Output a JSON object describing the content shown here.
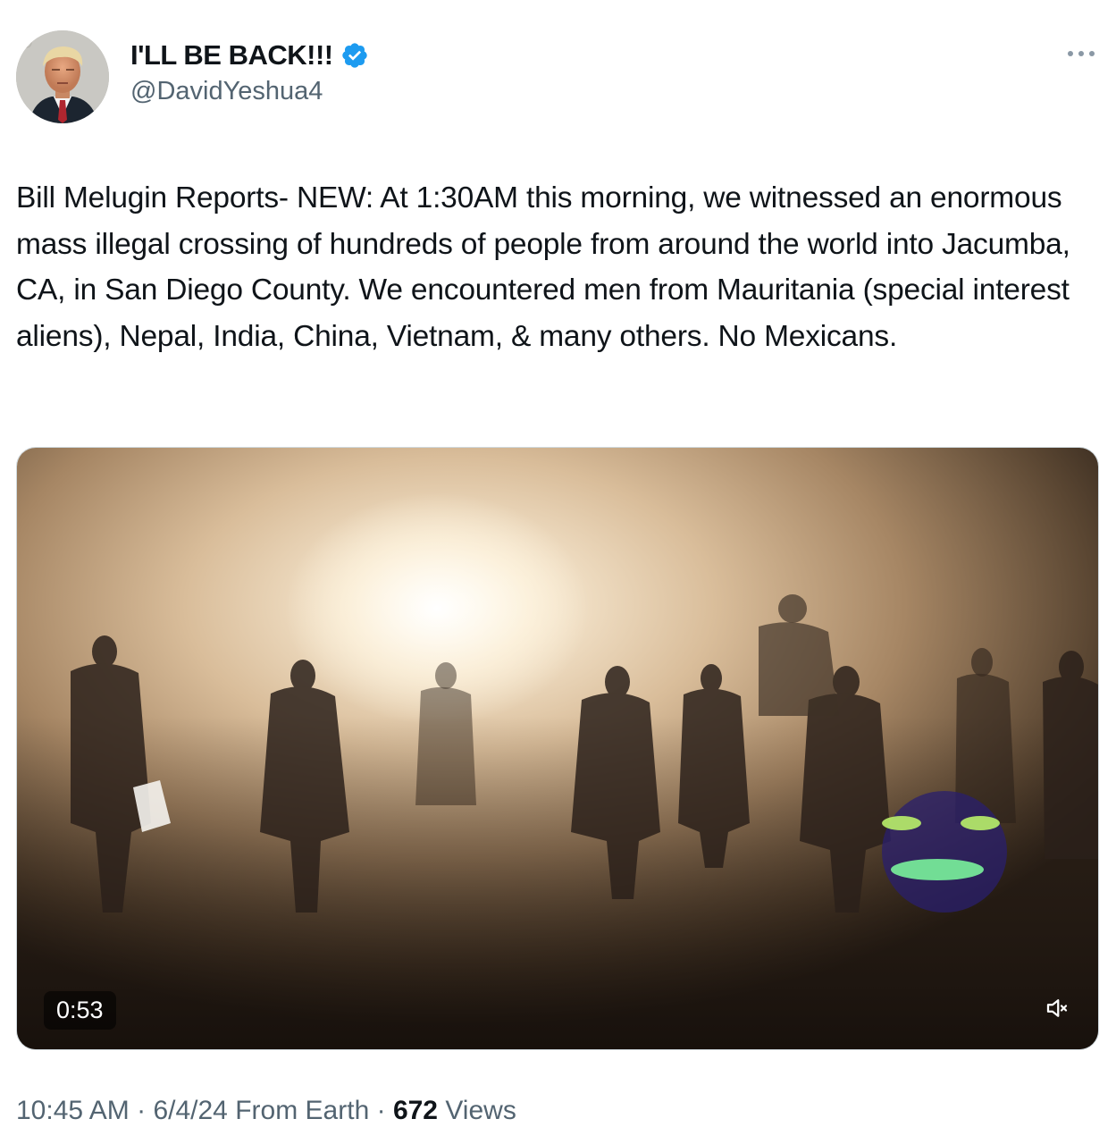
{
  "author": {
    "display_name": "I'LL BE BACK!!!",
    "handle": "@DavidYeshua4",
    "verified": true,
    "avatar_icon": "profile-photo"
  },
  "post": {
    "text": "Bill Melugin Reports- NEW: At 1:30AM this morning, we witnessed an enormous mass illegal crossing of hundreds of people from around the world into Jacumba, CA, in San Diego County. We encountered men from Mauritania (special interest aliens), Nepal, India, China, Vietnam, & many others. No Mexicans."
  },
  "media": {
    "type": "video",
    "duration": "0:53",
    "muted": true
  },
  "meta": {
    "time": "10:45 AM",
    "date": "6/4/24",
    "source": "From Earth",
    "separator": "·",
    "views_count": "672",
    "views_label": "Views"
  },
  "colors": {
    "text_primary": "#0f1419",
    "text_secondary": "#536471",
    "verified_blue": "#1d9bf0",
    "border": "#cfd9de"
  }
}
